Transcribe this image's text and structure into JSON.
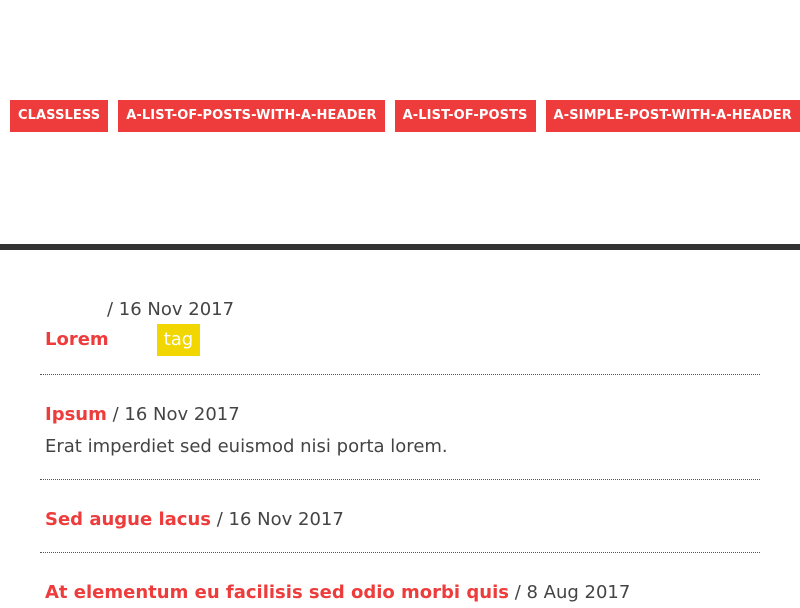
{
  "nav": {
    "items": [
      {
        "label": "CLASSLESS"
      },
      {
        "label": "A-LIST-OF-POSTS-WITH-A-HEADER"
      },
      {
        "label": "A-LIST-OF-POSTS"
      },
      {
        "label": "A-SIMPLE-POST-WITH-A-HEADER"
      }
    ]
  },
  "colors": {
    "accent": "#ee3b3b",
    "tag": "#f2d600",
    "divider": "#333333"
  },
  "posts": [
    {
      "title": "Lorem",
      "separator": "/",
      "date": "16 Nov 2017",
      "tag": "tag"
    },
    {
      "title": "Ipsum",
      "separator": "/",
      "date": "16 Nov 2017",
      "excerpt": "Erat imperdiet sed euismod nisi porta lorem."
    },
    {
      "title": "Sed augue lacus",
      "separator": "/",
      "date": "16 Nov 2017"
    },
    {
      "title": "At elementum eu facilisis sed odio morbi quis",
      "separator": "/",
      "date": "8 Aug 2017"
    }
  ]
}
